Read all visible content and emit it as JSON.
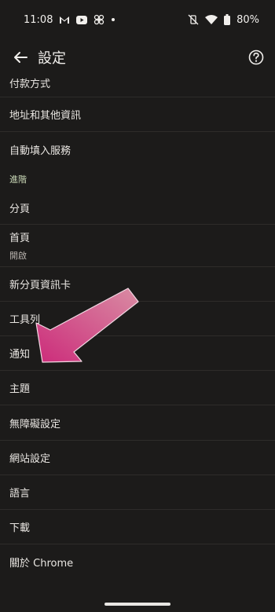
{
  "status_bar": {
    "time": "11:08",
    "icons_left": [
      "gmail-icon",
      "youtube-icon",
      "fan-icon",
      "dot-icon"
    ],
    "icons_right": [
      "vibrate-off-icon",
      "wifi-icon",
      "battery-icon"
    ],
    "battery": "80%"
  },
  "app_bar": {
    "title": "設定"
  },
  "settings": {
    "partial_top": "付款方式",
    "item_1": "地址和其他資訊",
    "item_2": "自動填入服務",
    "section_advanced": "進階",
    "item_tabs": "分頁",
    "item_home": "首頁",
    "item_home_sub": "開啟",
    "item_ntp": "新分頁資訊卡",
    "item_toolbar": "工具列",
    "item_notifications": "通知",
    "item_theme": "主題",
    "item_accessibility": "無障礙設定",
    "item_site": "網站設定",
    "item_language": "語言",
    "item_downloads": "下載",
    "item_about": "關於 Chrome"
  },
  "colors": {
    "background": "#1c1b1a",
    "divider": "#2e2c2a",
    "section_label": "#c9d8b6",
    "arrow_start": "#d98ca3",
    "arrow_end": "#cc2b7a"
  }
}
